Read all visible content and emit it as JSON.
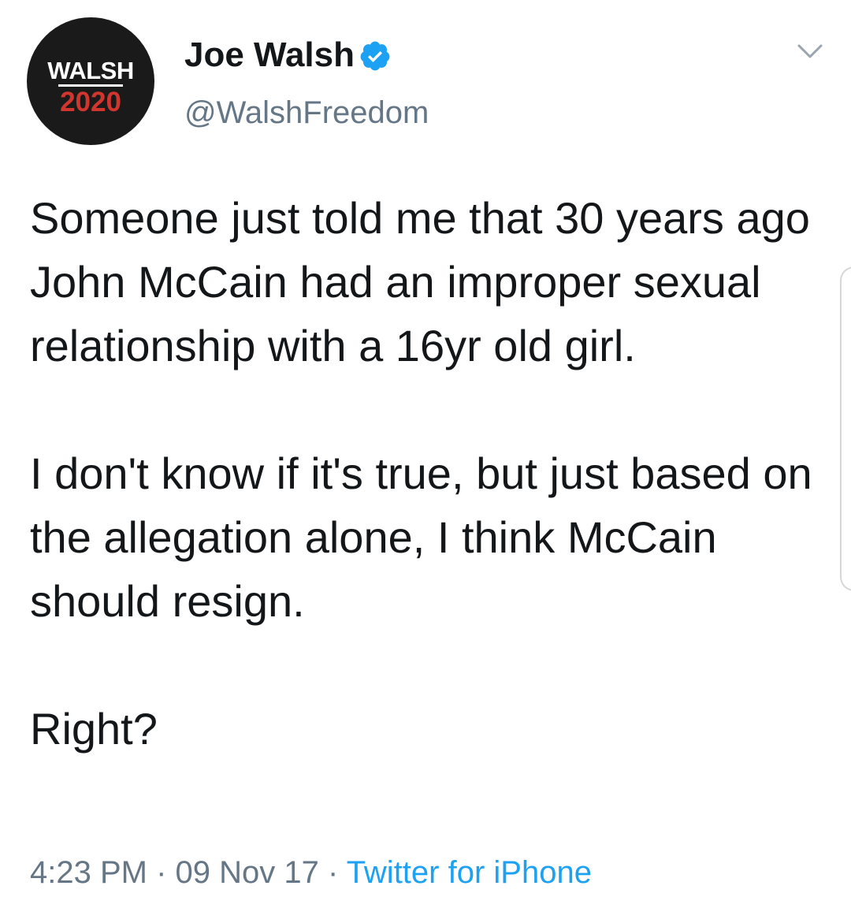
{
  "author": {
    "name": "Joe Walsh",
    "handle": "@WalshFreedom",
    "avatar": {
      "brand_top": "WALSH",
      "brand_bottom": "2020"
    },
    "verified_icon": "verified-badge-icon"
  },
  "tweet": {
    "paragraphs": [
      "Someone just told me that 30 years ago John McCain had an improper sexual relationship with a 16yr old girl.",
      "I don't know if it's true, but just based on the allegation alone, I think McCain should resign.",
      "Right?"
    ]
  },
  "meta": {
    "time": "4:23 PM",
    "separator": " · ",
    "date": "09 Nov 17",
    "source": "Twitter for iPhone"
  },
  "colors": {
    "text": "#14171a",
    "secondary": "#657786",
    "link": "#1da1f2",
    "verified": "#1da1f2",
    "avatar_bg": "#1a1a1a",
    "brand_red": "#d1362e"
  },
  "icons": {
    "menu": "chevron-down-icon"
  }
}
